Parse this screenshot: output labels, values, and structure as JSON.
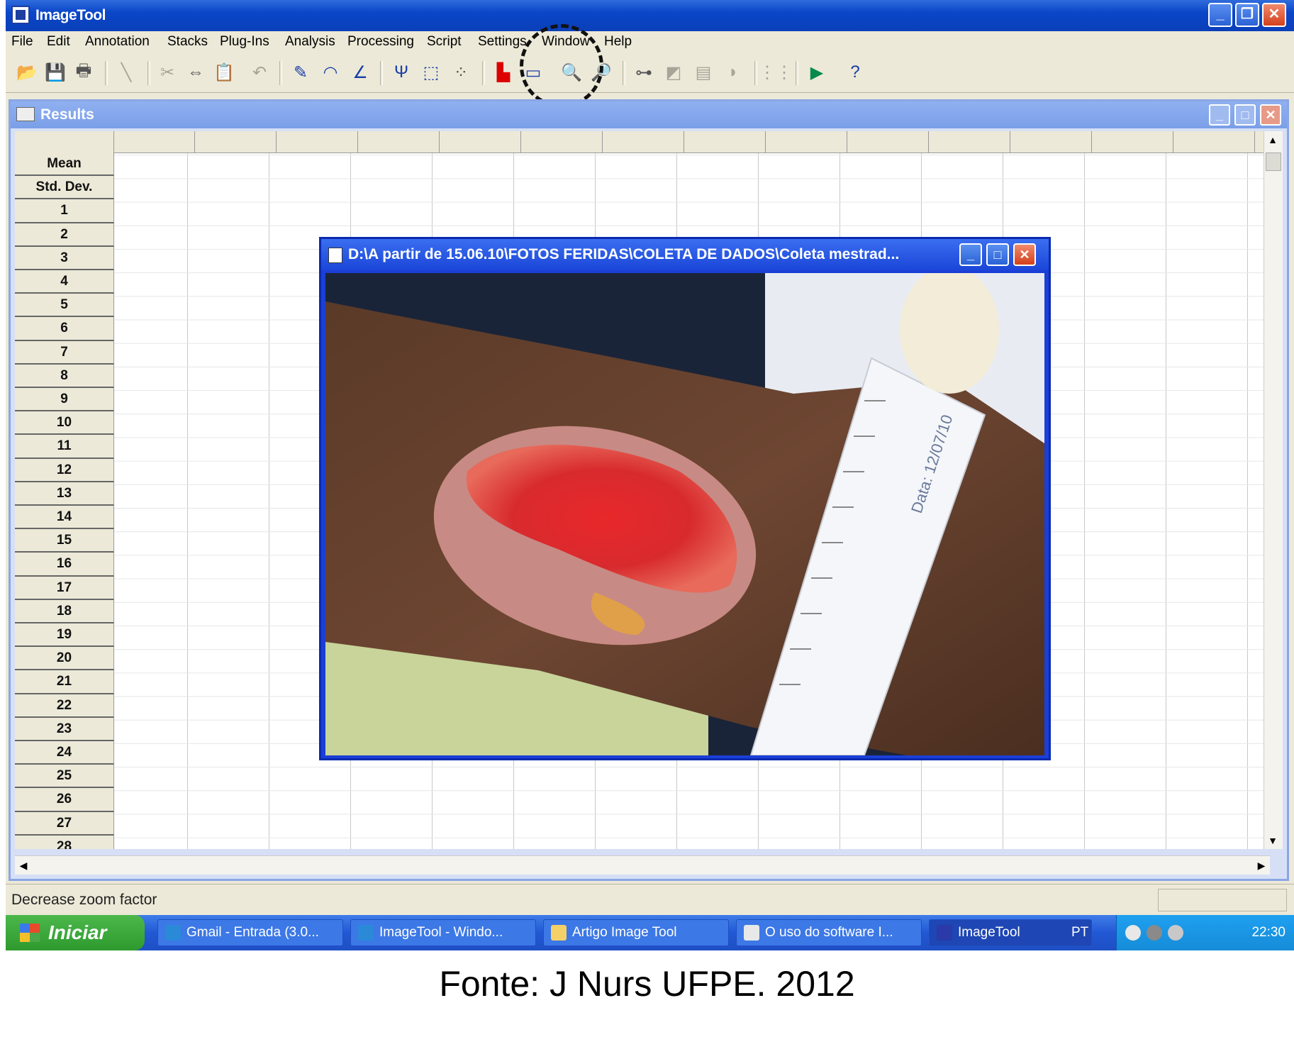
{
  "app": {
    "title": "ImageTool"
  },
  "menu": [
    "File",
    "Edit",
    "Annotation",
    "Stacks",
    "Plug-Ins",
    "Analysis",
    "Processing",
    "Script",
    "Settings",
    "Window",
    "Help"
  ],
  "toolbar": {
    "icons": [
      "open-icon",
      "save-icon",
      "print-icon",
      "line-icon",
      "cut-icon",
      "copy-icon",
      "paste-icon",
      "undo-icon",
      "pencil-icon",
      "freehand-icon",
      "angle-icon",
      "fork-icon",
      "select-icon",
      "points-icon",
      "histogram-icon",
      "image-icon",
      "zoom-in-icon",
      "zoom-out-icon",
      "binary-icon",
      "levels-icon",
      "calculator-icon",
      "shade-icon",
      "grid-icon",
      "run-icon",
      "help-icon"
    ]
  },
  "results": {
    "title": "Results",
    "row_labels": [
      "Mean",
      "Std. Dev.",
      "1",
      "2",
      "3",
      "4",
      "5",
      "6",
      "7",
      "8",
      "9",
      "10",
      "11",
      "12",
      "13",
      "14",
      "15",
      "16",
      "17",
      "18",
      "19",
      "20",
      "21",
      "22",
      "23",
      "24",
      "25",
      "26",
      "27",
      "28"
    ]
  },
  "image_window": {
    "title": "D:\\A partir de 15.06.10\\FOTOS FERIDAS\\COLETA DE DADOS\\Coleta mestrad...",
    "photo_ruler_label": "Data: 12/07/10"
  },
  "status": {
    "text": "Decrease zoom factor"
  },
  "taskbar": {
    "start_label": "Iniciar",
    "tasks": [
      "Gmail - Entrada (3.0...",
      "ImageTool - Windo...",
      "Artigo Image Tool",
      "O uso do software I...",
      "ImageTool"
    ],
    "language": "PT",
    "clock": "22:30"
  },
  "caption": "Fonte: J Nurs UFPE. 2012",
  "colors": {
    "titlebar": "#0a46c8",
    "taskbar": "#2258d4",
    "start": "#2e9a2e",
    "chrome": "#ece9d8"
  }
}
